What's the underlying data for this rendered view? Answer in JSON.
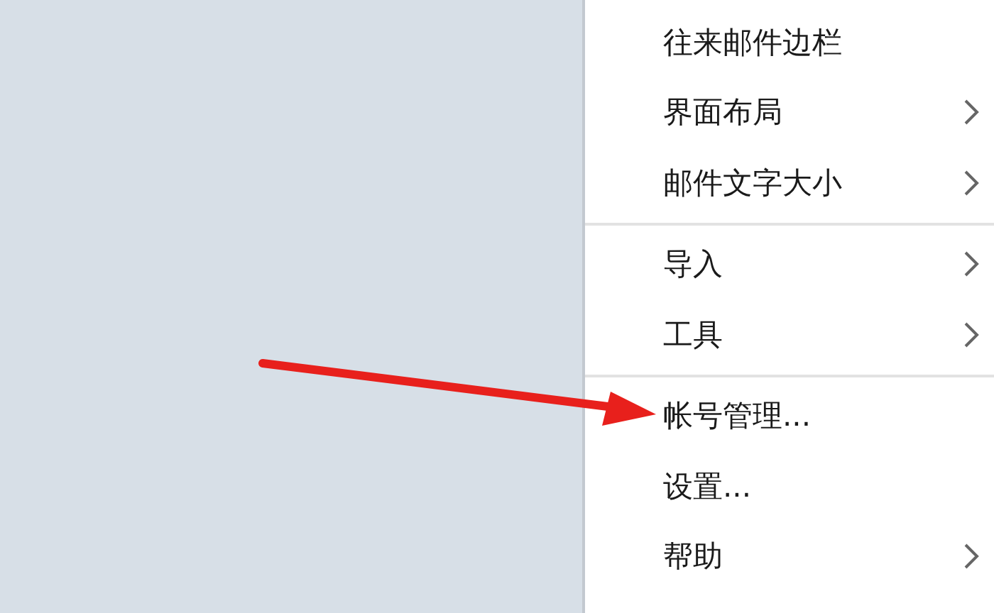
{
  "menu": {
    "groups": [
      {
        "items": [
          {
            "label": "往来邮件边栏",
            "submenu": false
          },
          {
            "label": "界面布局",
            "submenu": true
          },
          {
            "label": "邮件文字大小",
            "submenu": true
          }
        ]
      },
      {
        "items": [
          {
            "label": "导入",
            "submenu": true
          },
          {
            "label": "工具",
            "submenu": true
          }
        ]
      },
      {
        "items": [
          {
            "label": "帐号管理...",
            "submenu": false
          },
          {
            "label": "设置...",
            "submenu": false
          },
          {
            "label": "帮助",
            "submenu": true
          }
        ]
      }
    ]
  },
  "annotation": {
    "kind": "arrow"
  }
}
